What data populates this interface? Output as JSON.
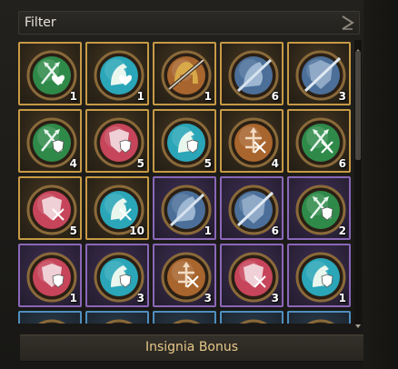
{
  "filter": {
    "label": "Filter"
  },
  "bonus": {
    "label": "Insignia Bonus"
  },
  "colors": {
    "gold_border": "#c79a45",
    "purple_border": "#8a67b8",
    "blue_border": "#4f8fbf",
    "green_medal": "#2f8a4a",
    "teal_medal": "#2aa6b8",
    "red_medal": "#c6455a",
    "bronze_medal": "#a8652e",
    "steel_medal": "#4b6f99"
  },
  "cells": [
    {
      "icon": "green-spears-heart-icon",
      "tier": "gold",
      "count": "1"
    },
    {
      "icon": "teal-horse-heart-icon",
      "tier": "gold",
      "count": "1"
    },
    {
      "icon": "gold-helmet-icon",
      "tier": "gold",
      "count": "1"
    },
    {
      "icon": "steel-horse-sword-icon",
      "tier": "gold",
      "count": "6"
    },
    {
      "icon": "steel-shield-sword-icon",
      "tier": "gold",
      "count": "3"
    },
    {
      "icon": "green-spears-shield-icon",
      "tier": "gold",
      "count": "4"
    },
    {
      "icon": "red-shield-shield-icon",
      "tier": "gold",
      "count": "5"
    },
    {
      "icon": "teal-horse-shield-icon",
      "tier": "gold",
      "count": "5"
    },
    {
      "icon": "bronze-arrows-crossed-icon",
      "tier": "gold",
      "count": "4"
    },
    {
      "icon": "green-spears-crossed-icon",
      "tier": "gold",
      "count": "6"
    },
    {
      "icon": "red-shield-crossed-icon",
      "tier": "gold",
      "count": "5"
    },
    {
      "icon": "teal-horse-crossed-icon",
      "tier": "gold",
      "count": "10"
    },
    {
      "icon": "steel-horse-shield-icon",
      "tier": "purple",
      "count": "1"
    },
    {
      "icon": "steel-shield-sword-icon",
      "tier": "purple",
      "count": "6"
    },
    {
      "icon": "green-spears-shield-icon",
      "tier": "purple",
      "count": "2"
    },
    {
      "icon": "red-shield-shield-icon",
      "tier": "purple",
      "count": "1"
    },
    {
      "icon": "teal-horse-shield-icon",
      "tier": "purple",
      "count": "3"
    },
    {
      "icon": "bronze-arrows-crossed-icon",
      "tier": "purple",
      "count": "3"
    },
    {
      "icon": "red-shield-crossed-icon",
      "tier": "purple",
      "count": "3"
    },
    {
      "icon": "teal-horse-shield-icon",
      "tier": "purple",
      "count": "1"
    },
    {
      "icon": "gold-helmet-icon",
      "tier": "blue",
      "count": ""
    },
    {
      "icon": "bronze-arrows-crossed-icon",
      "tier": "blue",
      "count": ""
    },
    {
      "icon": "teal-horse-shield-icon",
      "tier": "blue",
      "count": ""
    },
    {
      "icon": "red-shield-shield-icon",
      "tier": "blue",
      "count": ""
    },
    {
      "icon": "teal-horse-crossed-icon",
      "tier": "blue",
      "count": ""
    }
  ]
}
